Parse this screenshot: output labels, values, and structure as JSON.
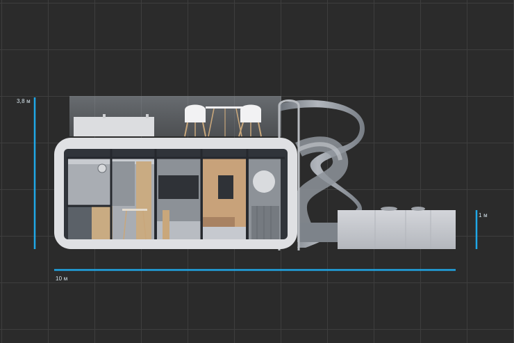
{
  "dimensions": {
    "height": "3,8 м",
    "deck_height": "1 м",
    "length": "10 м"
  },
  "colors": {
    "background": "#2b2b2b",
    "grid_line": "#3e3e3e",
    "dimension_line": "#1fa8e8",
    "module_frame": "#dfe0e3",
    "glass_frame": "#2e3238",
    "slide": "#9aa0a8",
    "deck": "#c7c9ce"
  },
  "icons": [
    "clock-icon",
    "round-mirror-icon",
    "chair-icon",
    "table-icon",
    "ladder-handrail-icon"
  ]
}
